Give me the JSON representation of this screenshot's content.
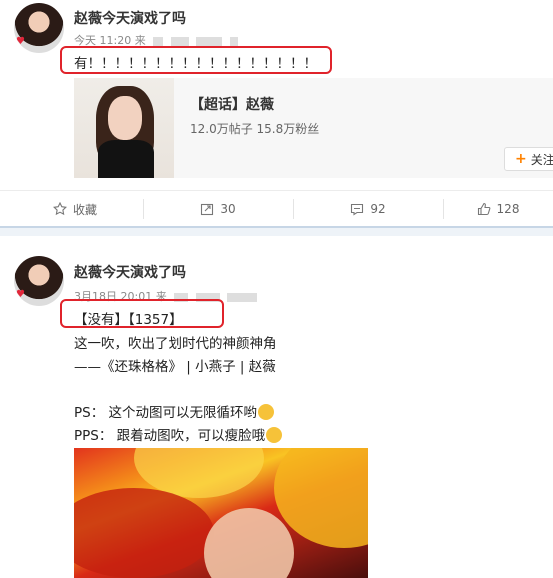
{
  "post1": {
    "username": "赵薇今天演戏了吗",
    "time": "今天 11:20",
    "source_prefix": "来",
    "content": "有！！！！！！！！！！！！！！！！！",
    "card": {
      "title": "【超话】赵薇",
      "stats": "12.0万帖子  15.8万粉丝",
      "follow_label": "关注"
    },
    "actions": {
      "favorite": "收藏",
      "repost": "30",
      "comment": "92",
      "like": "128"
    }
  },
  "post2": {
    "username": "赵薇今天演戏了吗",
    "time": "3月18日 20:01",
    "source_prefix": "来",
    "lines": [
      "【没有】【1357】",
      "这一吹，吹出了划时代的神颜神角",
      "——《还珠格格》 | 小燕子 | 赵薇",
      "PS：  这个动图可以无限循环哟",
      "PPS：  跟着动图吹，可以瘦脸哦"
    ]
  },
  "colors": {
    "highlight_box": "#e0232b",
    "follow_plus": "#ff8200",
    "separator": "#eef3f8"
  }
}
